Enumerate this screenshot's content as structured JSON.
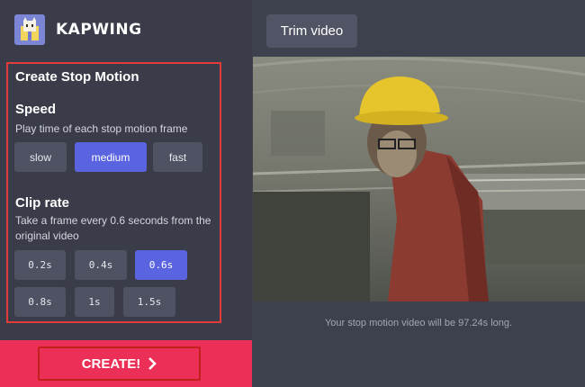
{
  "brand": {
    "name": "KAPWING",
    "logo_icon": "kapwing-logo-icon"
  },
  "panel": {
    "title": "Create Stop Motion",
    "speed": {
      "title": "Speed",
      "description": "Play time of each stop motion frame",
      "options": [
        "slow",
        "medium",
        "fast"
      ],
      "selected": "medium"
    },
    "clip_rate": {
      "title": "Clip rate",
      "description_line1": "Take a frame every 0.6 seconds from the",
      "description_line2": "original video",
      "options": [
        "0.2s",
        "0.4s",
        "0.6s",
        "0.8s",
        "1s",
        "1.5s"
      ],
      "selected": "0.6s"
    }
  },
  "create_button": {
    "label": "CREATE!",
    "icon": "chevron-right-icon"
  },
  "main": {
    "trim_button": "Trim video",
    "caption": "Your stop motion video will be 97.24s long."
  },
  "colors": {
    "sidebar_bg": "#3a3d49",
    "accent": "#5a64e0",
    "create_bg": "#ec2f56",
    "highlight_border": "#e53a3a"
  }
}
